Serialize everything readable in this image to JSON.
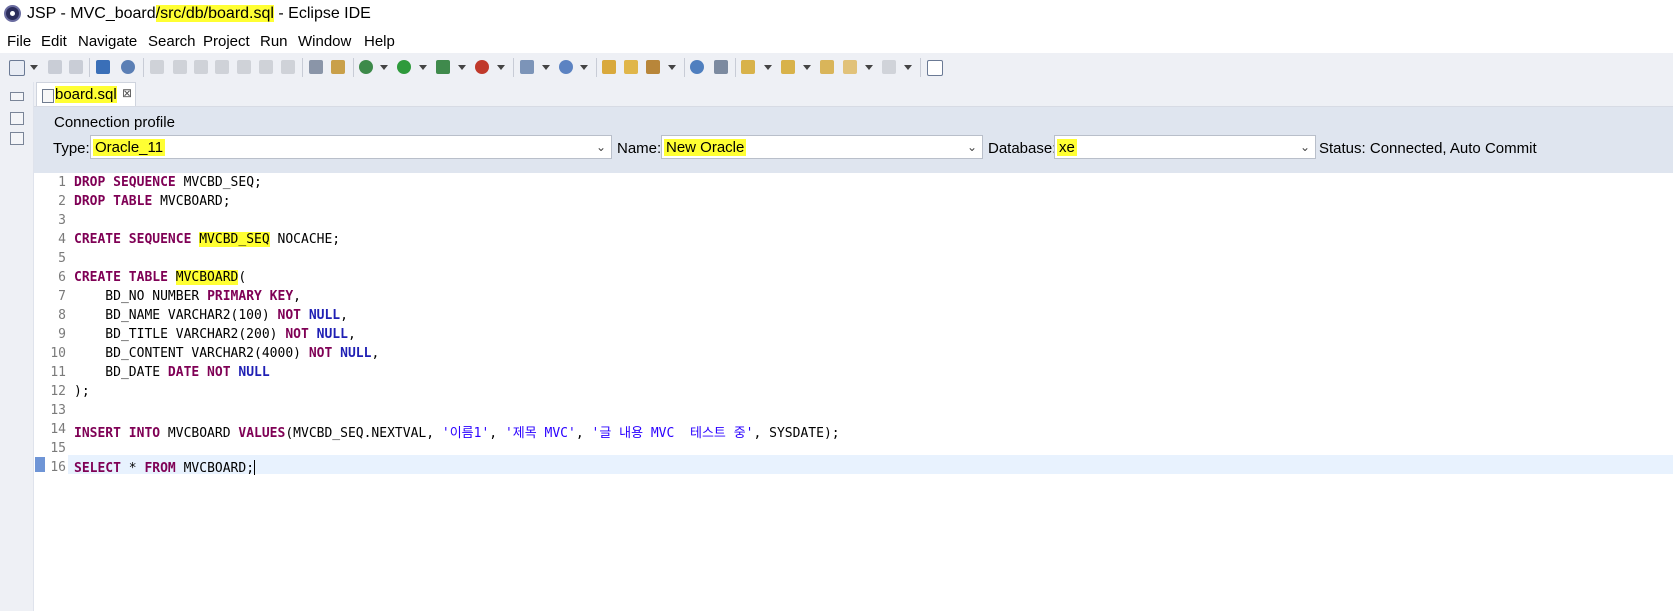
{
  "window": {
    "title_prefix": "JSP - MVC_board",
    "title_path": "/src/db/board.sql",
    "title_suffix": " - Eclipse IDE"
  },
  "menu": [
    "File",
    "Edit",
    "Navigate",
    "Search",
    "Project",
    "Run",
    "Window",
    "Help"
  ],
  "editor_tab": {
    "label": "board.sql",
    "close": "⊠"
  },
  "connection": {
    "title": "Connection profile",
    "type_label": "Type:",
    "type_value": "Oracle_11",
    "name_label": "Name:",
    "name_value": "New Oracle",
    "database_label": "Database:",
    "database_value": "xe",
    "status": "Status: Connected, Auto Commit"
  },
  "code": {
    "line_numbers": [
      "1",
      "2",
      "3",
      "4",
      "5",
      "6",
      "7",
      "8",
      "9",
      "10",
      "11",
      "12",
      "13",
      "14",
      "15",
      "16"
    ],
    "l1": {
      "kw": "DROP SEQUENCE",
      "rest": " MVCBD_SEQ;"
    },
    "l2": {
      "kw": "DROP TABLE",
      "rest": " MVCBOARD;"
    },
    "l4": {
      "kw": "CREATE SEQUENCE",
      "name": "MVCBD_SEQ",
      "rest": " NOCACHE;"
    },
    "l6": {
      "kw": "CREATE TABLE",
      "name": "MVCBOARD",
      "rest": "("
    },
    "l7": {
      "col": "    BD_NO NUMBER ",
      "kw": "PRIMARY KEY",
      "rest": ","
    },
    "l8": {
      "col": "    BD_NAME VARCHAR2(100) ",
      "kw": "NOT",
      "kw2": "NULL",
      "rest": ","
    },
    "l9": {
      "col": "    BD_TITLE VARCHAR2(200) ",
      "kw": "NOT",
      "kw2": "NULL",
      "rest": ","
    },
    "l10": {
      "col": "    BD_CONTENT VARCHAR2(4000) ",
      "kw": "NOT",
      "kw2": "NULL",
      "rest": ","
    },
    "l11": {
      "col": "    BD_DATE ",
      "kw": "DATE NOT",
      "kw2": "NULL"
    },
    "l12": {
      "text": ");"
    },
    "l14": {
      "kw": "INSERT INTO",
      "mid": " MVCBOARD ",
      "kw_values": "VALUES",
      "args": "(MVCBD_SEQ.NEXTVAL, ",
      "s1": "'이름1'",
      "sep1": ", ",
      "s2": "'제목 MVC'",
      "sep2": ", ",
      "s3": "'글 내용 MVC  테스트 중'",
      "end": ", SYSDATE);"
    },
    "l16": {
      "kw": "SELECT",
      "star": " * ",
      "kw_from": "FROM",
      "rest": " MVCBOARD;"
    }
  }
}
